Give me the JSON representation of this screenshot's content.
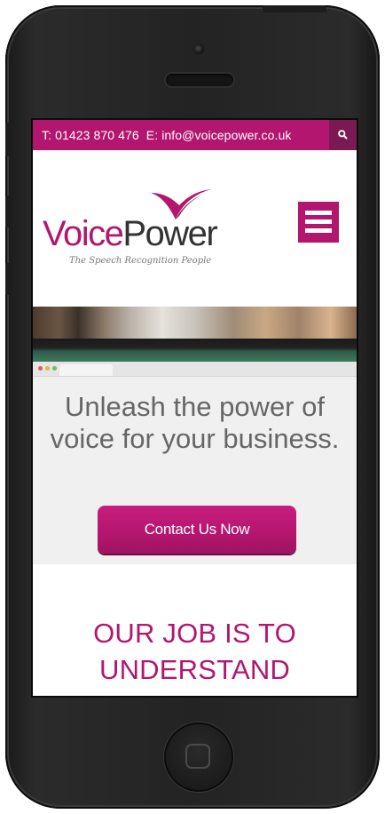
{
  "topbar": {
    "phone": "T: 01423 870 476",
    "email": "E: info@voicepower.co.uk"
  },
  "logo": {
    "voice": "Voice",
    "power": "Power",
    "tagline": "The Speech Recognition People"
  },
  "hero": {
    "headline": "Unleash the power of voice for your business.",
    "cta_label": "Contact Us Now"
  },
  "section": {
    "title": "OUR JOB IS TO UNDERSTAND"
  },
  "icons": {
    "search": "search-icon",
    "menu": "hamburger-menu-icon",
    "logo_mark": "logo-swoosh-icon"
  },
  "colors": {
    "brand": "#b3166e",
    "brand_dark": "#7a1a53",
    "heading_gray": "#666666"
  }
}
